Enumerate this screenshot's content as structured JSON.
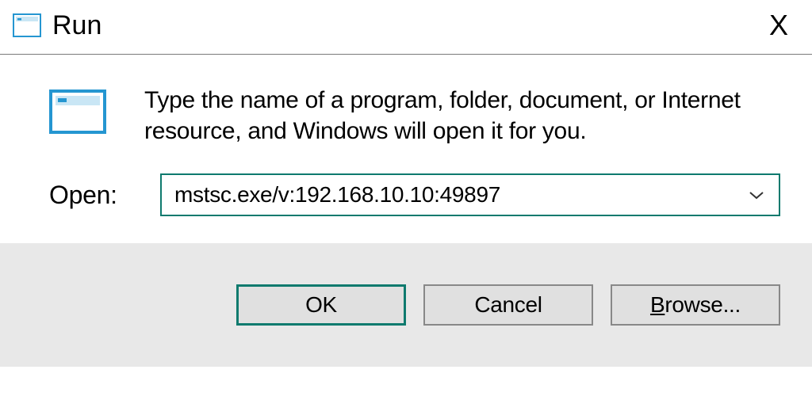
{
  "window": {
    "title": "Run",
    "close_label": "X"
  },
  "content": {
    "description": "Type the name of a program, folder, document, or Internet resource, and Windows will open it for you.",
    "open_label": "Open:",
    "command_value": "mstsc.exe/v:192.168.10.10:49897"
  },
  "buttons": {
    "ok": "OK",
    "cancel": "Cancel",
    "browse": "Browse..."
  },
  "icons": {
    "run_small": "run-icon",
    "run_large": "run-icon",
    "chevron": "chevron-down-icon"
  }
}
